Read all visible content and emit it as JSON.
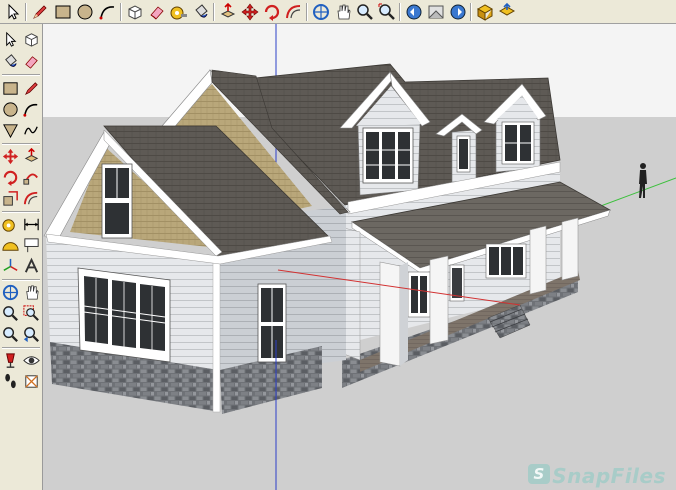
{
  "toolbar": {
    "icons": [
      "select-icon",
      "pencil-icon",
      "rectangle-icon",
      "circle-icon",
      "arc-icon",
      "eraser-icon",
      "paint-bucket-icon",
      "tape-measure-icon",
      "push-pull-icon",
      "move-icon",
      "rotate-icon",
      "offset-icon",
      "orbit-icon",
      "pan-icon",
      "zoom-icon",
      "zoom-extents-icon",
      "previous-view-icon",
      "next-view-icon",
      "position-camera-icon",
      "look-around-icon",
      "walk-icon",
      "get-models-icon"
    ]
  },
  "palette": {
    "icons": [
      "select-icon",
      "component-icon",
      "paint-bucket-icon",
      "eraser-icon",
      "rectangle-icon",
      "line-icon",
      "circle-icon",
      "arc-icon",
      "polygon-icon",
      "freehand-icon",
      "move-icon",
      "push-pull-icon",
      "rotate-icon",
      "follow-me-icon",
      "scale-icon",
      "offset-icon",
      "tape-measure-icon",
      "dimension-icon",
      "protractor-icon",
      "text-icon",
      "axes-icon",
      "3d-text-icon",
      "orbit-icon",
      "pan-icon",
      "zoom-icon",
      "zoom-window-icon",
      "zoom-extents-icon",
      "previous-view-icon",
      "position-camera-icon",
      "look-around-icon",
      "walk-icon",
      "section-plane-icon"
    ]
  },
  "viewport": {
    "sky_color": "#f4f4f4",
    "ground_color": "#cfcfcf"
  },
  "watermark": {
    "badge": "S",
    "text": "SnapFiles"
  }
}
